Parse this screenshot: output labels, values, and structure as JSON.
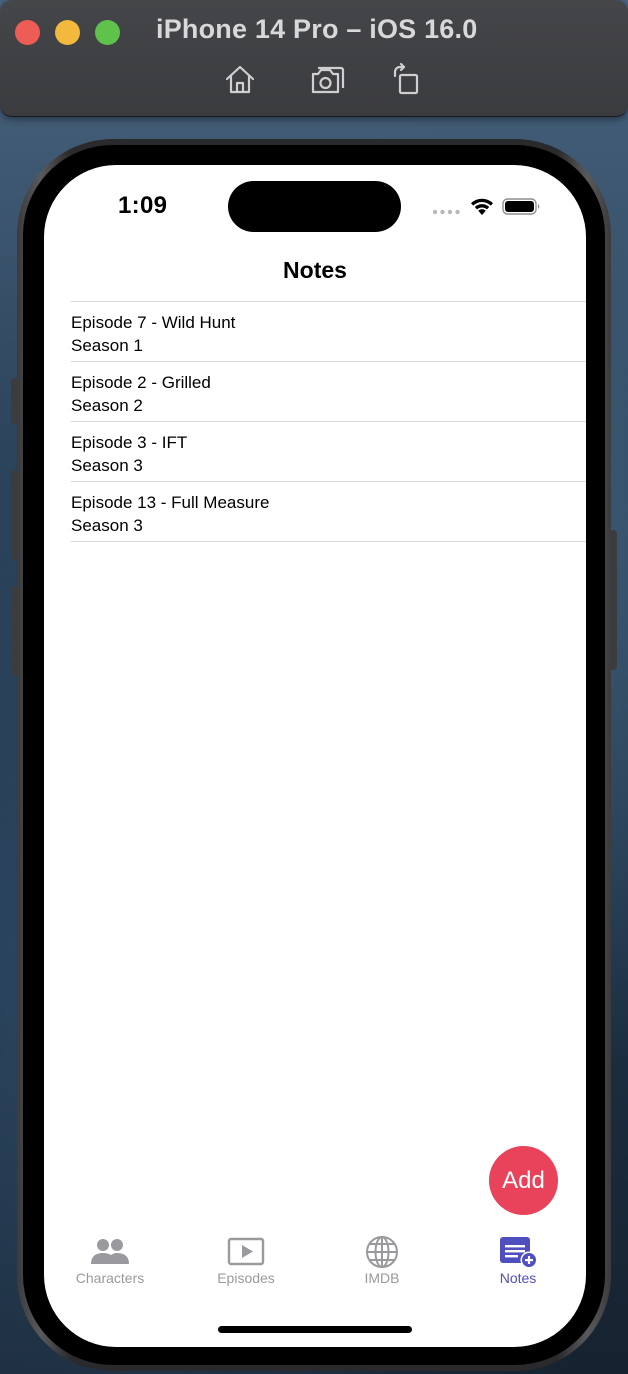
{
  "window": {
    "title": "iPhone 14 Pro – iOS 16.0",
    "toolbar_icons": [
      "home-icon",
      "screenshot-icon",
      "rotate-icon"
    ]
  },
  "status_bar": {
    "time": "1:09",
    "icons": [
      "cellular-signal-icon",
      "wifi-icon",
      "battery-icon"
    ]
  },
  "nav": {
    "title": "Notes"
  },
  "notes": [
    {
      "title": "Episode 7 - Wild Hunt",
      "season": "Season 1"
    },
    {
      "title": "Episode 2 - Grilled",
      "season": "Season 2"
    },
    {
      "title": "Episode 3 - IFT",
      "season": "Season 3"
    },
    {
      "title": "Episode 13 - Full Measure",
      "season": "Season 3"
    }
  ],
  "fab": {
    "label": "Add",
    "color": "#e8435b"
  },
  "tab_bar": {
    "active": "Notes",
    "active_color": "#4f4fbf",
    "inactive_color": "#9a9a9e",
    "tabs": [
      {
        "label": "Characters",
        "icon": "people-icon"
      },
      {
        "label": "Episodes",
        "icon": "play-rectangle-icon"
      },
      {
        "label": "IMDB",
        "icon": "globe-icon"
      },
      {
        "label": "Notes",
        "icon": "note-add-icon"
      }
    ]
  }
}
